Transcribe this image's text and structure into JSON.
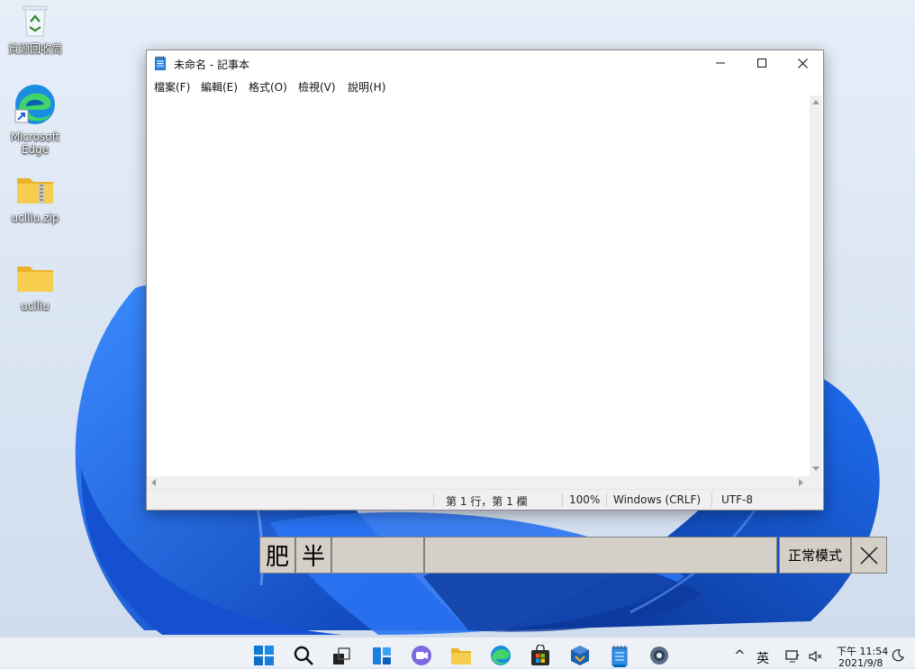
{
  "desktop": {
    "icons": [
      {
        "label": "資源回收筒",
        "icon": "recycle-bin-icon"
      },
      {
        "label": "Microsoft Edge",
        "icon": "edge-icon"
      },
      {
        "label": "uclliu.zip",
        "icon": "zip-folder-icon"
      },
      {
        "label": "uclliu",
        "icon": "folder-icon"
      }
    ]
  },
  "notepad": {
    "title": "未命名 - 記事本",
    "menu": [
      "檔案(F)",
      "編輯(E)",
      "格式(O)",
      "檢視(V)",
      "說明(H)"
    ],
    "content": "",
    "status": {
      "position": "第 1 行，第 1 欄",
      "zoom": "100%",
      "line_ending": "Windows (CRLF)",
      "encoding": "UTF-8"
    }
  },
  "ime": {
    "mode_char": "肥",
    "width_char": "半",
    "composition": "",
    "candidates": "",
    "mode_label": "正常模式",
    "close_glyph": "✕"
  },
  "taskbar": {
    "apps": [
      "start-icon",
      "search-icon",
      "task-view-icon",
      "widgets-icon",
      "chat-icon",
      "file-explorer-icon",
      "edge-icon",
      "store-icon",
      "virtualbox-icon",
      "notepad-icon",
      "settings-icon"
    ],
    "tray": {
      "chevron": "^",
      "language": "英",
      "time": "下午 11:54",
      "date": "2021/9/8"
    }
  },
  "colors": {
    "accent": "#0067c0",
    "wallpaper_blue": "#1a5fd6",
    "ime_face": "#d4d0c8"
  }
}
